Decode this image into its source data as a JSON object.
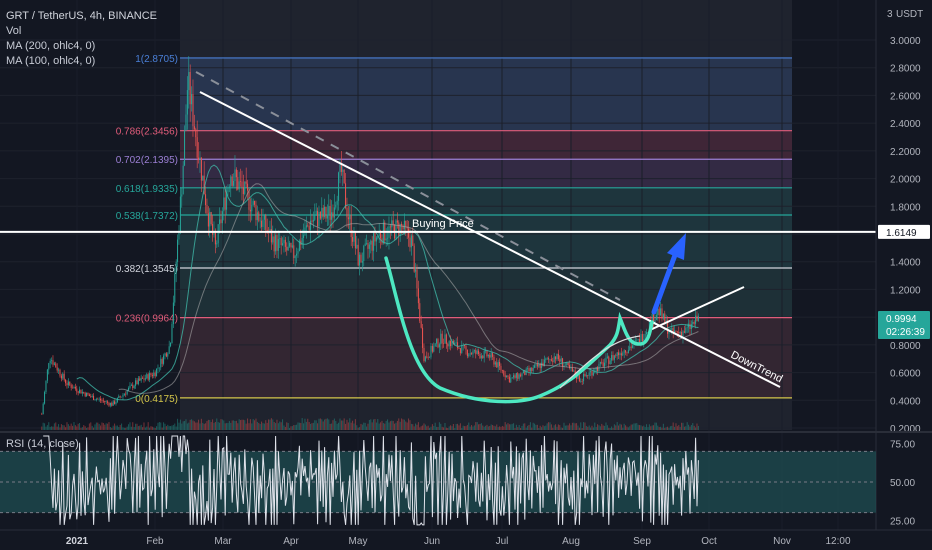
{
  "header": {
    "title": "GRT / TetherUS, 4h, BINANCE",
    "indicators": [
      "Vol",
      "MA (200, ohlc4, 0)",
      "MA (100, ohlc4, 0)"
    ]
  },
  "currency_label": "USDT",
  "rsi": {
    "label": "RSI (14, close)",
    "ticks": [
      "75.00",
      "50.00",
      "25.00"
    ],
    "levels": [
      70,
      50,
      30
    ]
  },
  "colors": {
    "background": "#131722",
    "up": "#26a69a",
    "down": "#ef5350",
    "trendline": "#ffffff",
    "cup_curve": "#4de8c2",
    "arrow": "#2962ff",
    "price_tag": "#26a69a"
  },
  "chart_data": {
    "type": "candlestick",
    "x_ticks": [
      "2021",
      "Feb",
      "Mar",
      "Apr",
      "May",
      "Jun",
      "Jul",
      "Aug",
      "Sep",
      "Oct",
      "Nov",
      "12:00"
    ],
    "y_ticks": [
      "3.0000",
      "2.8000",
      "2.6000",
      "2.4000",
      "2.2000",
      "2.0000",
      "1.8000",
      "1.6000",
      "1.4000",
      "1.2000",
      "1.0000",
      "0.8000",
      "0.6000",
      "0.4000",
      "0.2000"
    ],
    "y_top_tick": "3",
    "ylim": [
      0.2,
      3.0
    ],
    "fib_levels": [
      {
        "ratio": "1",
        "price": 2.8705,
        "label": "1(2.8705)",
        "color": "#4a7fd6"
      },
      {
        "ratio": "0.786",
        "price": 2.3456,
        "label": "0.786(2.3456)",
        "color": "#e05c7a"
      },
      {
        "ratio": "0.702",
        "price": 2.1395,
        "label": "0.702(2.1395)",
        "color": "#9b7fd4"
      },
      {
        "ratio": "0.618",
        "price": 1.9335,
        "label": "0.618(1.9335)",
        "color": "#26a69a"
      },
      {
        "ratio": "0.538",
        "price": 1.7372,
        "label": "0.538(1.7372)",
        "color": "#26a69a"
      },
      {
        "ratio": "0.382",
        "price": 1.3545,
        "label": "0.382(1.3545)",
        "color": "#d1d4dc"
      },
      {
        "ratio": "0.236",
        "price": 0.9964,
        "label": "0.236(0.9964)",
        "color": "#e05c7a"
      },
      {
        "ratio": "0",
        "price": 0.4175,
        "label": "0(0.4175)",
        "color": "#d4c64a"
      }
    ],
    "horizontal_line": {
      "price": 1.6149,
      "label": "1.6149",
      "text": "Buying Price"
    },
    "current_price": {
      "value": "0.9994",
      "countdown": "02:26:39"
    },
    "annotations": [
      "DownTrend",
      "Buying Price"
    ],
    "price_path": [
      {
        "date": "2020-12-18",
        "price": 0.3
      },
      {
        "date": "2020-12-21",
        "price": 0.72
      },
      {
        "date": "2020-12-28",
        "price": 0.52
      },
      {
        "date": "2021-01-06",
        "price": 0.43
      },
      {
        "date": "2021-01-15",
        "price": 0.37
      },
      {
        "date": "2021-01-24",
        "price": 0.52
      },
      {
        "date": "2021-02-01",
        "price": 0.6
      },
      {
        "date": "2021-02-07",
        "price": 0.8
      },
      {
        "date": "2021-02-12",
        "price": 2.05
      },
      {
        "date": "2021-02-14",
        "price": 2.7
      },
      {
        "date": "2021-02-17",
        "price": 2.35
      },
      {
        "date": "2021-02-22",
        "price": 1.75
      },
      {
        "date": "2021-02-25",
        "price": 1.5
      },
      {
        "date": "2021-03-03",
        "price": 2.05
      },
      {
        "date": "2021-03-12",
        "price": 1.8
      },
      {
        "date": "2021-03-20",
        "price": 1.55
      },
      {
        "date": "2021-03-28",
        "price": 1.45
      },
      {
        "date": "2021-04-04",
        "price": 1.7
      },
      {
        "date": "2021-04-12",
        "price": 1.75
      },
      {
        "date": "2021-04-16",
        "price": 2.05
      },
      {
        "date": "2021-04-18",
        "price": 1.8
      },
      {
        "date": "2021-04-23",
        "price": 1.4
      },
      {
        "date": "2021-05-01",
        "price": 1.6
      },
      {
        "date": "2021-05-10",
        "price": 1.65
      },
      {
        "date": "2021-05-14",
        "price": 1.55
      },
      {
        "date": "2021-05-19",
        "price": 0.7
      },
      {
        "date": "2021-05-26",
        "price": 0.85
      },
      {
        "date": "2021-06-05",
        "price": 0.75
      },
      {
        "date": "2021-06-14",
        "price": 0.72
      },
      {
        "date": "2021-06-22",
        "price": 0.55
      },
      {
        "date": "2021-07-01",
        "price": 0.62
      },
      {
        "date": "2021-07-10",
        "price": 0.72
      },
      {
        "date": "2021-07-20",
        "price": 0.55
      },
      {
        "date": "2021-07-28",
        "price": 0.65
      },
      {
        "date": "2021-08-05",
        "price": 0.75
      },
      {
        "date": "2021-08-12",
        "price": 0.82
      },
      {
        "date": "2021-08-20",
        "price": 1.05
      },
      {
        "date": "2021-08-25",
        "price": 0.88
      },
      {
        "date": "2021-08-31",
        "price": 0.9
      },
      {
        "date": "2021-09-05",
        "price": 0.99
      }
    ]
  }
}
